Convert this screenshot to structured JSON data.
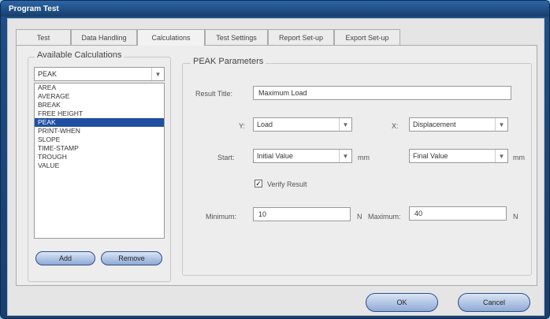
{
  "window": {
    "title": "Program Test"
  },
  "tabs": [
    "Test",
    "Data Handling",
    "Calculations",
    "Test Settings",
    "Report Set-up",
    "Export Set-up"
  ],
  "available_calculations": {
    "title": "Available Calculations",
    "selected": "PEAK",
    "items": [
      "AREA",
      "AVERAGE",
      "BREAK",
      "FREE HEIGHT",
      "PEAK",
      "PRINT-WHEN",
      "SLOPE",
      "TIME-STAMP",
      "TROUGH",
      "VALUE"
    ],
    "add_label": "Add",
    "remove_label": "Remove"
  },
  "parameters": {
    "title": "PEAK Parameters",
    "result_title_label": "Result Title:",
    "result_title_value": "Maximum Load",
    "y_label": "Y:",
    "y_value": "Load",
    "x_label": "X:",
    "x_value": "Displacement",
    "start_label": "Start:",
    "start_value": "Initial Value",
    "start_unit": "mm",
    "end_value": "Final Value",
    "end_unit": "mm",
    "verify_label": "Verify Result",
    "minimum_label": "Minimum:",
    "minimum_value": "10",
    "minimum_unit": "N",
    "maximum_label": "Maximum:",
    "maximum_value": "40",
    "maximum_unit": "N"
  },
  "footer": {
    "ok_label": "OK",
    "cancel_label": "Cancel"
  },
  "icons": {
    "dropdown": "chevron-down-icon",
    "check": "checkmark-icon"
  },
  "colors": {
    "title_bar": "#1e4f86",
    "selection": "#1f4fa3",
    "button": "#8fa9d6"
  }
}
